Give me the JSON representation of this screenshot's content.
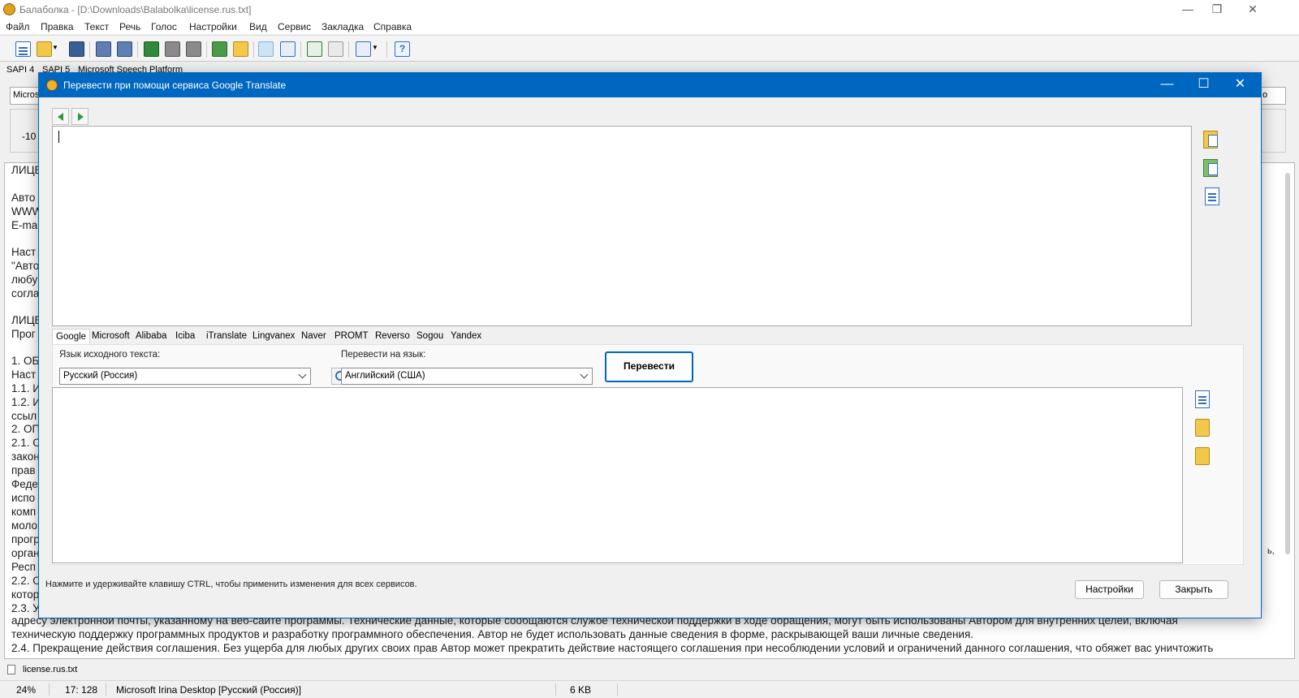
{
  "window": {
    "title": "Балаболка - [D:\\Downloads\\Balabolka\\license.rus.txt]",
    "minimize": "—",
    "maximize": "❐",
    "close": "✕"
  },
  "menu": [
    "Файл",
    "Правка",
    "Текст",
    "Речь",
    "Голос",
    "Настройки",
    "Вид",
    "Сервис",
    "Закладка",
    "Справка"
  ],
  "sapi_tabs": [
    "SAPI 4",
    "SAPI 5",
    "Microsoft Speech Platform"
  ],
  "voice": {
    "combo_value": "Micros",
    "combo_right": "o",
    "rate_value": "-10"
  },
  "editor": {
    "lines": [
      "ЛИЦЕ",
      "",
      "Авто",
      "WWW",
      "E-ma",
      "",
      "Наст",
      "\"Авто",
      "любу",
      "согла",
      "",
      "ЛИЦЕ",
      "Прог",
      "",
      "1. ОБ",
      "Наст",
      "1.1. И",
      "1.2. И",
      "ссыл",
      "2. ОП",
      "2.1. О",
      "закон",
      "прав",
      "Феде",
      "испо",
      "комп",
      "моло",
      "прогр",
      "орган",
      "Респ",
      "2.2. О",
      "котор",
      "2.3. У"
    ],
    "right_fragment": "ь,",
    "bottom_lines": [
      "адресу электронной почты, указанному на веб-сайте программы. Технические данные, которые сообщаются службе технической поддержки в ходе обращения, могут быть использованы Автором для внутренних целей, включая",
      "техническую поддержку программных продуктов и разработку программного обеспечения. Автор не будет использовать данные сведения в форме, раскрывающей ваши личные сведения.",
      "2.4. Прекращение действия соглашения. Без ущерба для любых других своих прав Автор может прекратить действие настоящего соглашения при несоблюдении условий и ограничений данного соглашения, что обяжет вас уничтожить"
    ]
  },
  "doc_tab": "license.rus.txt",
  "status": {
    "zoom": "24%",
    "position": "17: 128",
    "voice": "Microsoft Irina Desktop [Русский (Россия)]",
    "size": "6 KB"
  },
  "dialog": {
    "title": "Перевести при помощи сервиса Google Translate",
    "minimize": "—",
    "maximize": "☐",
    "close": "✕",
    "service_tabs": [
      "Google",
      "Microsoft",
      "Alibaba",
      "Iciba",
      "iTranslate",
      "Lingvanex",
      "Naver",
      "PROMT",
      "Reverso",
      "Sogou",
      "Yandex"
    ],
    "source_label": "Язык исходного текста:",
    "source_value": "Русский (Россия)",
    "target_label": "Перевести на язык:",
    "target_value": "Английский (США)",
    "translate_button": "Перевести",
    "hint": "Нажмите и удерживайте клавишу CTRL, чтобы применить изменения для всех сервисов.",
    "settings_button": "Настройки",
    "close_button": "Закрыть"
  },
  "colors": {
    "accent": "#0067c0",
    "folder": "#f2c84b",
    "doc": "#2f6fb7"
  },
  "icons": {
    "toolbar": [
      "new-file-icon",
      "open-file-icon",
      "save-icon",
      "convert-icon",
      "convert-batch-icon",
      "play-icon",
      "pause-icon",
      "stop-icon",
      "read-clipboard-icon",
      "read-file-icon",
      "split-view-icon",
      "translate-icon",
      "bookmark-prev-icon",
      "bookmark-next-icon",
      "options-icon",
      "help-icon"
    ],
    "dialog_side": [
      "paste-clipboard-icon",
      "paste-special-icon",
      "text-file-icon",
      "copy-icon",
      "open-folder-icon",
      "save-folder-icon"
    ]
  }
}
